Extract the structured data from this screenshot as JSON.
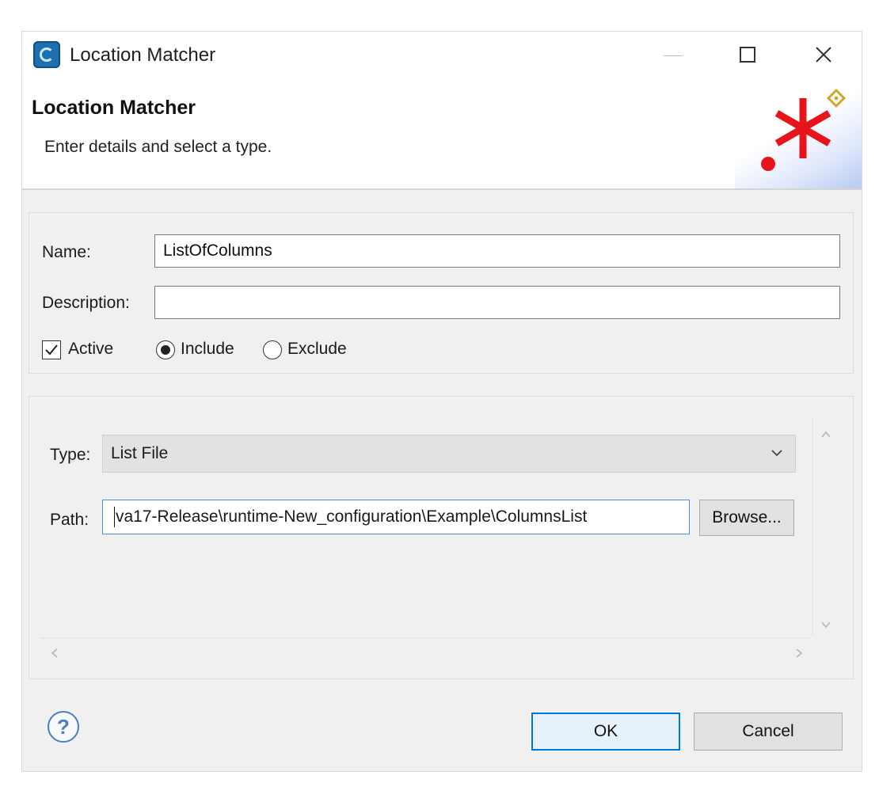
{
  "window": {
    "title": "Location Matcher"
  },
  "banner": {
    "title": "Location Matcher",
    "subtitle": "Enter details and select a type."
  },
  "form": {
    "name_label": "Name:",
    "name_value": "ListOfColumns",
    "description_label": "Description:",
    "description_value": "",
    "active_label": "Active",
    "active_checked": true,
    "include_label": "Include",
    "exclude_label": "Exclude",
    "selected_mode": "Include"
  },
  "type_section": {
    "type_label": "Type:",
    "type_value": "List File",
    "path_label": "Path:",
    "path_value": "va17-Release\\runtime-New_configuration\\Example\\ColumnsList",
    "browse_label": "Browse..."
  },
  "footer": {
    "ok_label": "OK",
    "cancel_label": "Cancel"
  },
  "icons": {
    "app": "app-icon",
    "minimize": "minimize-icon",
    "maximize": "maximize-icon",
    "close": "close-icon",
    "banner": "red-asterisk-icon",
    "help": "help-icon",
    "dropdown": "chevron-down-icon"
  },
  "colors": {
    "accent": "#0078d7",
    "focus_border": "#4a90d9",
    "banner_asterisk": "#e8141c"
  }
}
